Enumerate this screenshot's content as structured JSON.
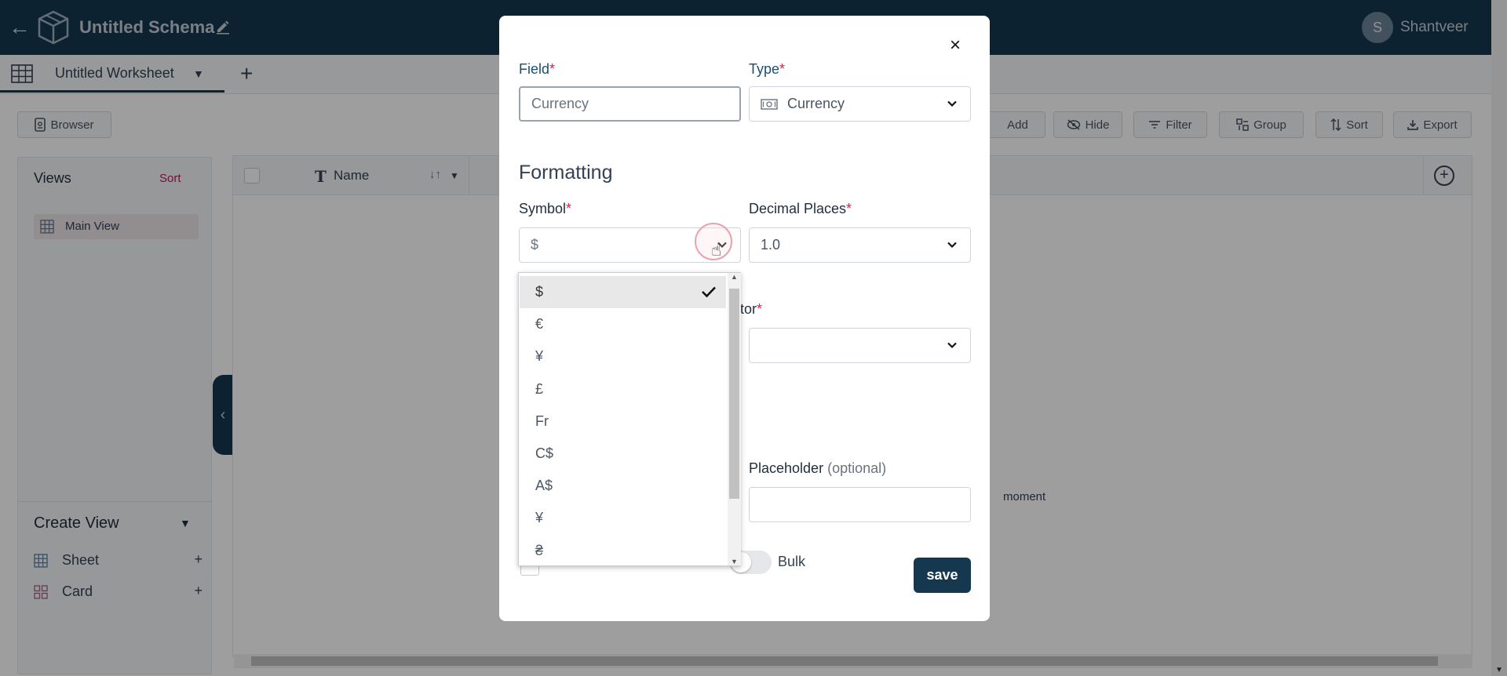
{
  "header": {
    "title": "Untitled Schema",
    "user_initial": "S",
    "user_name": "Shantveer"
  },
  "tabs": {
    "worksheet": "Untitled Worksheet",
    "add": "+"
  },
  "toolbar": {
    "browser": "Browser",
    "add": "Add",
    "hide": "Hide",
    "filter": "Filter",
    "group": "Group",
    "sort": "Sort",
    "export": "Export"
  },
  "sidebar": {
    "views_title": "Views",
    "views_sort": "Sort",
    "main_view": "Main View",
    "create_view_title": "Create View",
    "create_items": [
      {
        "label": "Sheet",
        "plus": "+"
      },
      {
        "label": "Card",
        "plus": "+"
      }
    ]
  },
  "grid": {
    "name_column": "Name",
    "partial_text": "moment"
  },
  "modal": {
    "field_label": "Field",
    "field_value": "Currency",
    "type_label": "Type",
    "type_value": "Currency",
    "formatting_title": "Formatting",
    "symbol_label": "Symbol",
    "symbol_value": "$",
    "decimal_label": "Decimal Places",
    "decimal_value": "1.0",
    "separator_partial_label": "tor",
    "placeholder_label": "Placeholder",
    "placeholder_optional": "(optional)",
    "placeholder_value": "",
    "bulk_label": "Bulk",
    "save_label": "save",
    "required_mark": "*",
    "close_glyph": "×"
  },
  "symbol_options": [
    "$",
    "€",
    "¥",
    "£",
    "Fr",
    "C$",
    "A$",
    "¥",
    "₴"
  ],
  "selected_symbol_index": 0,
  "colors": {
    "header_bg": "#16384f",
    "accent": "#16384f",
    "required": "#e11d48",
    "sort_link": "#c2185b"
  }
}
